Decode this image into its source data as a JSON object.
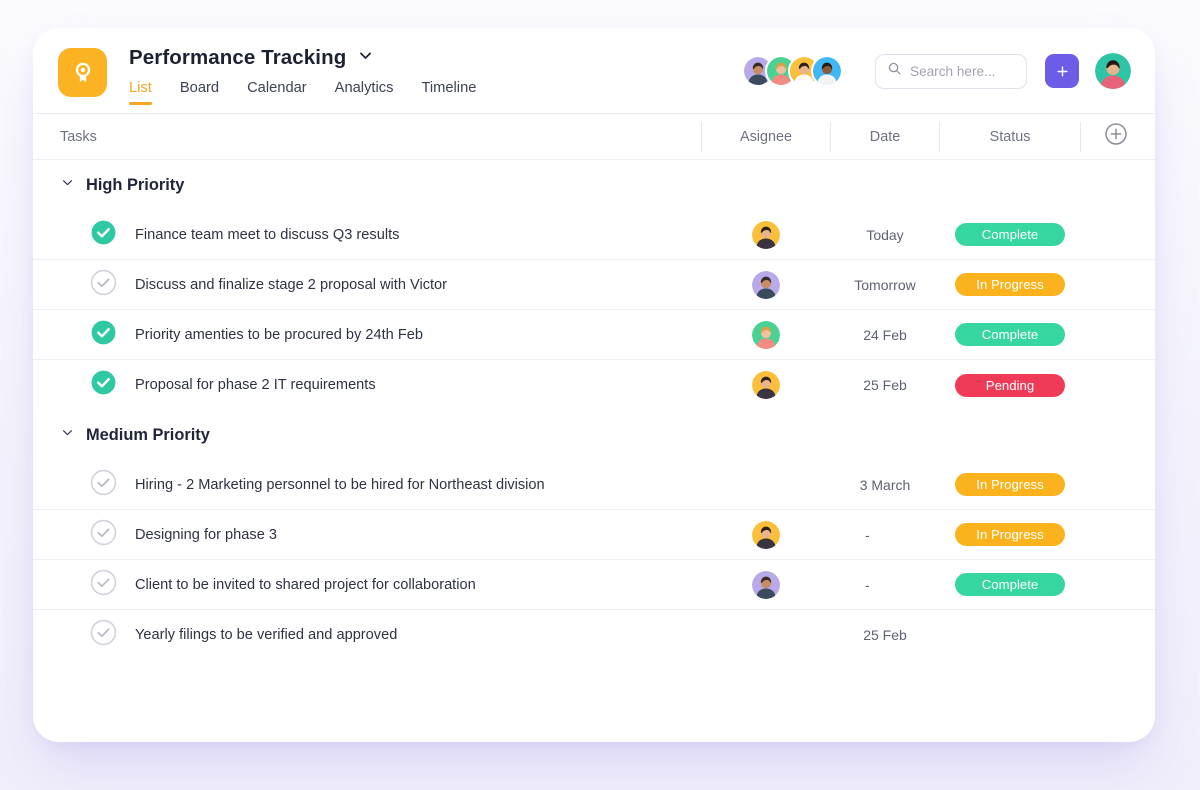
{
  "app": {
    "title": "Performance Tracking",
    "logo_icon": "award-badge-icon",
    "title_chevron_icon": "chevron-down-icon"
  },
  "tabs": [
    {
      "label": "List",
      "active": true
    },
    {
      "label": "Board",
      "active": false
    },
    {
      "label": "Calendar",
      "active": false
    },
    {
      "label": "Analytics",
      "active": false
    },
    {
      "label": "Timeline",
      "active": false
    }
  ],
  "header": {
    "member_avatars": [
      {
        "name": "member-avatar-1",
        "bg": "#b8a9e8",
        "skin": "#c98d63",
        "hair": "#3a2c24",
        "shirt": "#3c4a5e"
      },
      {
        "name": "member-avatar-2",
        "bg": "#4ad295",
        "skin": "#f0c0a0",
        "hair": "#d9a04a",
        "shirt": "#f28b82"
      },
      {
        "name": "member-avatar-3",
        "bg": "#fbbf3b",
        "skin": "#e8b48c",
        "hair": "#2f2119",
        "shirt": "#ffffff"
      },
      {
        "name": "member-avatar-4",
        "bg": "#3fb8f5",
        "skin": "#8b5a3c",
        "hair": "#2b1d16",
        "shirt": "#f3f3f3"
      }
    ],
    "search": {
      "placeholder": "Search here...",
      "value": "",
      "icon": "search-icon"
    },
    "add_button": {
      "label": "+",
      "icon": "plus-icon",
      "color": "#6c5ce7"
    },
    "profile_avatar": {
      "name": "profile-avatar",
      "bg": "#2ec4a6",
      "skin": "#e8b48c",
      "hair": "#2b1a14",
      "shirt": "#e8637a"
    }
  },
  "columns": {
    "tasks": "Tasks",
    "assignee": "Asignee",
    "date": "Date",
    "status": "Status",
    "add_icon": "circle-plus-icon"
  },
  "sections": [
    {
      "title": "High Priority",
      "chevron_icon": "chevron-down-icon",
      "rows": [
        {
          "task": "Finance team meet to discuss Q3 results",
          "checked": true,
          "date": "Today",
          "status": "Complete",
          "status_type": "complete",
          "avatar": {
            "bg": "#fbbf3b",
            "skin": "#e8b48c",
            "hair": "#2f2119",
            "shirt": "#3a3340"
          }
        },
        {
          "task": "Discuss and finalize stage 2 proposal with Victor",
          "checked": false,
          "date": "Tomorrow",
          "status": "In Progress",
          "status_type": "inprogress",
          "avatar": {
            "bg": "#b8a9e8",
            "skin": "#c98d63",
            "hair": "#3a2c24",
            "shirt": "#3c4a5e"
          }
        },
        {
          "task": "Priority amenties to be procured by 24th Feb",
          "checked": true,
          "date": "24 Feb",
          "status": "Complete",
          "status_type": "complete",
          "avatar": {
            "bg": "#4ad295",
            "skin": "#f0c0a0",
            "hair": "#d9a04a",
            "shirt": "#f28b82"
          }
        },
        {
          "task": "Proposal for phase 2 IT requirements",
          "checked": true,
          "date": "25 Feb",
          "status": "Pending",
          "status_type": "pending",
          "avatar": {
            "bg": "#fbbf3b",
            "skin": "#e8b48c",
            "hair": "#2f2119",
            "shirt": "#3a3340"
          }
        }
      ]
    },
    {
      "title": "Medium Priority",
      "chevron_icon": "chevron-down-icon",
      "rows": [
        {
          "task": "Hiring - 2 Marketing personnel to be hired for Northeast division",
          "checked": false,
          "date": "3 March",
          "status": "In Progress",
          "status_type": "inprogress",
          "avatar": null
        },
        {
          "task": "Designing for phase 3",
          "checked": false,
          "date": "-",
          "status": "In Progress",
          "status_type": "inprogress",
          "avatar": {
            "bg": "#fbbf3b",
            "skin": "#e8b48c",
            "hair": "#2f2119",
            "shirt": "#3a3340"
          }
        },
        {
          "task": "Client to be invited to shared project for collaboration",
          "checked": false,
          "date": "-",
          "status": "Complete",
          "status_type": "complete",
          "avatar": {
            "bg": "#b8a9e8",
            "skin": "#c98d63",
            "hair": "#3a2c24",
            "shirt": "#3c4a5e"
          }
        },
        {
          "task": "Yearly filings to be verified and approved",
          "checked": false,
          "date": "25 Feb",
          "status": "",
          "status_type": "none",
          "avatar": null
        }
      ]
    }
  ],
  "colors": {
    "brand_amber": "#fbb324",
    "accent_purple": "#6c5ce7",
    "status_complete": "#35d6a0",
    "status_inprogress": "#fbb31d",
    "status_pending": "#ef3b58",
    "check_done": "#2ec9a3"
  }
}
